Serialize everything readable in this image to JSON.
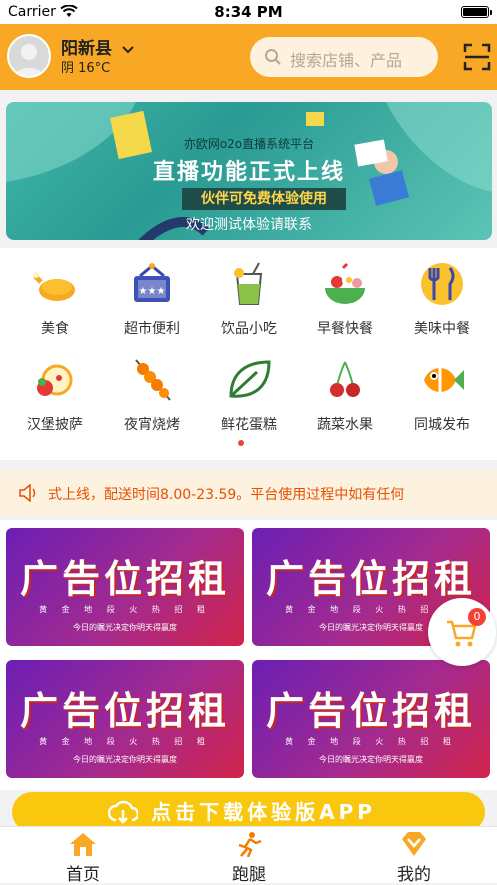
{
  "status_bar": {
    "carrier": "Carrier",
    "time": "8:34 PM"
  },
  "header": {
    "city": "阳新县",
    "weather": "阴 16°C",
    "search_placeholder": "搜索店铺、产品"
  },
  "banner": {
    "line1": "亦欧网o2o直播系统平台",
    "line2": "直播功能正式上线",
    "line3": "伙伴可免费体验使用",
    "line4": "欢迎测试体验请联系"
  },
  "categories": [
    {
      "label": "美食",
      "icon": "roast-chicken-icon"
    },
    {
      "label": "超市便利",
      "icon": "supermarket-basket-icon"
    },
    {
      "label": "饮品小吃",
      "icon": "drink-cup-icon"
    },
    {
      "label": "早餐快餐",
      "icon": "breakfast-bowl-icon"
    },
    {
      "label": "美味中餐",
      "icon": "fork-knife-icon"
    },
    {
      "label": "汉堡披萨",
      "icon": "pizza-icon"
    },
    {
      "label": "夜宵烧烤",
      "icon": "skewer-icon"
    },
    {
      "label": "鲜花蛋糕",
      "icon": "leaf-icon"
    },
    {
      "label": "蔬菜水果",
      "icon": "cherry-icon"
    },
    {
      "label": "同城发布",
      "icon": "fish-icon"
    }
  ],
  "notice": {
    "text": "式上线，配送时间8.00-23.59。平台使用过程中如有任何"
  },
  "ads": [
    {
      "title": "广告位招租",
      "sub": "黄 金 地 段 火 热 招 租",
      "sub2": "今日的瞩光决定你明天得赢度"
    },
    {
      "title": "广告位招租",
      "sub": "黄 金 地 段 火 热 招 租",
      "sub2": "今日的瞩光决定你明天得赢度"
    },
    {
      "title": "广告位招租",
      "sub": "黄 金 地 段 火 热 招 租",
      "sub2": "今日的瞩光决定你明天得赢度"
    },
    {
      "title": "广告位招租",
      "sub": "黄 金 地 段 火 热 招 租",
      "sub2": "今日的瞩光决定你明天得赢度"
    }
  ],
  "cart": {
    "count": "0"
  },
  "download": {
    "label": "点击下载体验版APP"
  },
  "tabs": [
    {
      "label": "首页",
      "icon": "home-icon"
    },
    {
      "label": "跑腿",
      "icon": "runner-icon"
    },
    {
      "label": "我的",
      "icon": "diamond-icon"
    }
  ],
  "colors": {
    "brand": "#f9a825",
    "notice_text": "#e65100",
    "badge": "#f44336"
  }
}
